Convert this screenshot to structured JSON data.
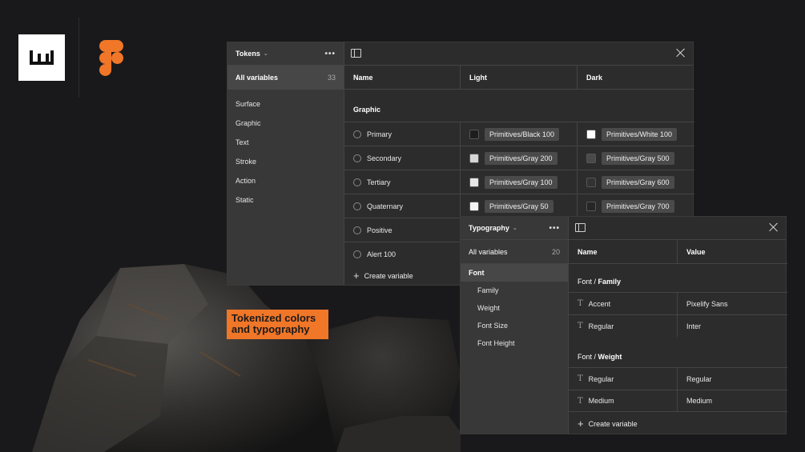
{
  "brand": {
    "logo_letter": "W"
  },
  "tokens_panel": {
    "title": "Tokens",
    "all_variables_label": "All variables",
    "all_variables_count": "33",
    "groups": [
      "Surface",
      "Graphic",
      "Text",
      "Stroke",
      "Action",
      "Static"
    ],
    "columns": [
      "Name",
      "Light",
      "Dark"
    ],
    "section": "Graphic",
    "rows": [
      {
        "name": "Primary",
        "light": "Primitives/Black 100",
        "light_color": "#1e1e1e",
        "dark": "Primitives/White 100",
        "dark_color": "#ffffff"
      },
      {
        "name": "Secondary",
        "light": "Primitives/Gray 200",
        "light_color": "#d6d6d6",
        "dark": "Primitives/Gray 500",
        "dark_color": "#4a4a4a"
      },
      {
        "name": "Tertiary",
        "light": "Primitives/Gray 100",
        "light_color": "#e6e6e6",
        "dark": "Primitives/Gray 600",
        "dark_color": "#333333"
      },
      {
        "name": "Quaternary",
        "light": "Primitives/Gray 50",
        "light_color": "#f2f2f2",
        "dark": "Primitives/Gray 700",
        "dark_color": "#262626"
      },
      {
        "name": "Positive"
      },
      {
        "name": "Alert 100"
      }
    ],
    "create_label": "Create variable"
  },
  "badge": {
    "line1": "Tokenized colors",
    "line2": "and typography"
  },
  "typo_panel": {
    "title": "Typography",
    "all_variables_label": "All variables",
    "all_variables_count": "20",
    "font_group": "Font",
    "sub_groups": [
      "Family",
      "Weight",
      "Font Size",
      "Font Height"
    ],
    "columns": [
      "Name",
      "Value"
    ],
    "family_section_prefix": "Font / ",
    "family_section": "Family",
    "family_rows": [
      {
        "name": "Accent",
        "value": "Pixelify Sans"
      },
      {
        "name": "Regular",
        "value": "Inter"
      }
    ],
    "weight_section_prefix": "Font / ",
    "weight_section": "Weight",
    "weight_rows": [
      {
        "name": "Regular",
        "value": "Regular"
      },
      {
        "name": "Medium",
        "value": "Medium"
      }
    ],
    "create_label": "Create variable"
  },
  "colors": {
    "accent": "#f07628",
    "background": "#19191b",
    "panel": "#2c2c2c"
  }
}
